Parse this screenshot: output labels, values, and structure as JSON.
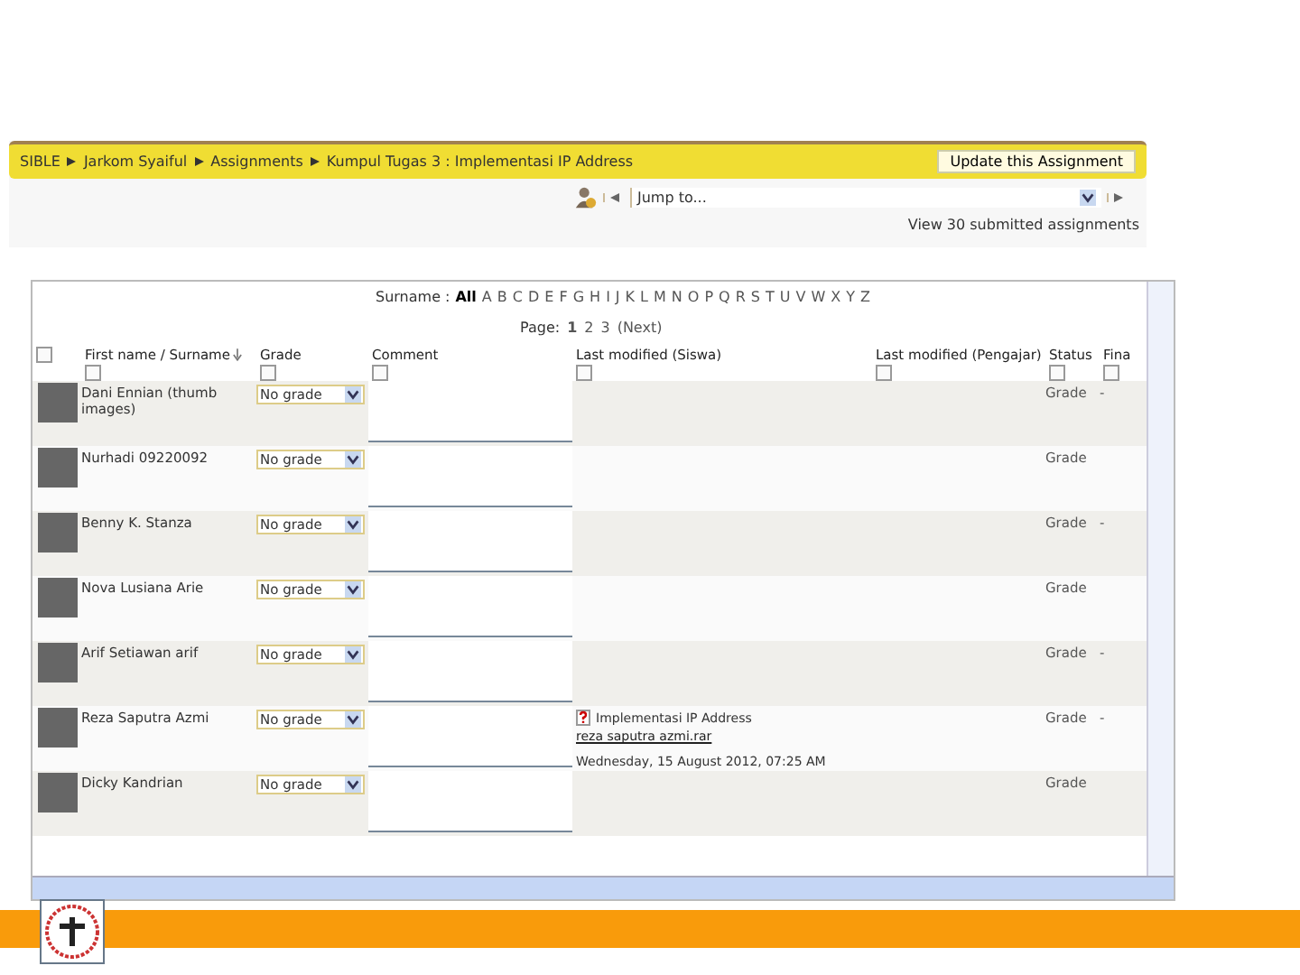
{
  "breadcrumb": [
    "SIBLE",
    "Jarkom Syaiful",
    "Assignments",
    "Kumpul Tugas 3 : Implementasi IP Address"
  ],
  "update_button": "Update this Assignment",
  "jump_select": {
    "value": "Jump to..."
  },
  "view_link": "View 30 submitted assignments",
  "surname_filter": {
    "label": "Surname :",
    "letters": [
      {
        "label": "All",
        "selected": true
      },
      {
        "label": "A",
        "selected": false
      },
      {
        "label": "B",
        "selected": false
      },
      {
        "label": "C",
        "selected": false
      },
      {
        "label": "D",
        "selected": false
      },
      {
        "label": "E",
        "selected": false
      },
      {
        "label": "F",
        "selected": false
      },
      {
        "label": "G",
        "selected": false
      },
      {
        "label": "H",
        "selected": false
      },
      {
        "label": "I",
        "selected": false
      },
      {
        "label": "J",
        "selected": false
      },
      {
        "label": "K",
        "selected": false
      },
      {
        "label": "L",
        "selected": false
      },
      {
        "label": "M",
        "selected": false
      },
      {
        "label": "N",
        "selected": false
      },
      {
        "label": "O",
        "selected": false
      },
      {
        "label": "P",
        "selected": false
      },
      {
        "label": "Q",
        "selected": false
      },
      {
        "label": "R",
        "selected": false
      },
      {
        "label": "S",
        "selected": false
      },
      {
        "label": "T",
        "selected": false
      },
      {
        "label": "U",
        "selected": false
      },
      {
        "label": "V",
        "selected": false
      },
      {
        "label": "W",
        "selected": false
      },
      {
        "label": "X",
        "selected": false
      },
      {
        "label": "Y",
        "selected": false
      },
      {
        "label": "Z",
        "selected": false
      }
    ]
  },
  "pagination": {
    "label": "Page:",
    "pages": [
      {
        "label": "1",
        "selected": true
      },
      {
        "label": "2",
        "selected": false
      },
      {
        "label": "3",
        "selected": false
      },
      {
        "label": "(Next)",
        "selected": false
      }
    ]
  },
  "table": {
    "columns": [
      "First name / Surname",
      "Grade",
      "Comment",
      "Last modified (Siswa)",
      "Last modified (Pengajar)",
      "Status",
      "Fina"
    ],
    "rows": [
      {
        "name": "Dani Ennian (thumb images)",
        "grade": "No grade",
        "status": "Grade",
        "final": "-"
      },
      {
        "name": "Nurhadi 09220092",
        "grade": "No grade",
        "status": "Grade"
      },
      {
        "name": "Benny K. Stanza",
        "grade": "No grade",
        "status": "Grade",
        "final": "-"
      },
      {
        "name": "Nova Lusiana Arie",
        "grade": "No grade",
        "status": "Grade"
      },
      {
        "name": "Arif Setiawan arif",
        "grade": "No grade",
        "status": "Grade",
        "final": "-"
      },
      {
        "name": "Reza Saputra Azmi",
        "grade": "No grade",
        "status": "Grade",
        "final": "-",
        "submission": {
          "title": "Implementasi IP Address",
          "file": "reza saputra azmi.rar",
          "date": "Wednesday, 15 August 2012, 07:25 AM"
        }
      },
      {
        "name": "Dicky Kandrian",
        "grade": "No grade",
        "status": "Grade"
      }
    ]
  }
}
